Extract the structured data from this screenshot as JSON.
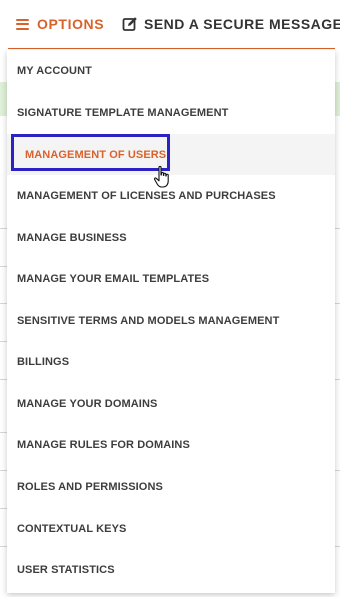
{
  "topbar": {
    "options_label": "OPTIONS",
    "send_label": "SEND A SECURE MESSAGE"
  },
  "menu": {
    "items": [
      {
        "label": "MY ACCOUNT"
      },
      {
        "label": "SIGNATURE TEMPLATE MANAGEMENT"
      },
      {
        "label": "MANAGEMENT OF USERS"
      },
      {
        "label": "MANAGEMENT OF LICENSES AND PURCHASES"
      },
      {
        "label": "MANAGE BUSINESS"
      },
      {
        "label": "MANAGE YOUR EMAIL TEMPLATES"
      },
      {
        "label": "SENSITIVE TERMS AND MODELS MANAGEMENT"
      },
      {
        "label": "BILLINGS"
      },
      {
        "label": "MANAGE YOUR DOMAINS"
      },
      {
        "label": "MANAGE RULES FOR DOMAINS"
      },
      {
        "label": "ROLES AND PERMISSIONS"
      },
      {
        "label": "CONTEXTUAL KEYS"
      },
      {
        "label": "USER STATISTICS"
      }
    ]
  },
  "colors": {
    "accent": "#d9622b",
    "focus": "#2b22c4",
    "hover_bg": "#f4f4f4"
  }
}
